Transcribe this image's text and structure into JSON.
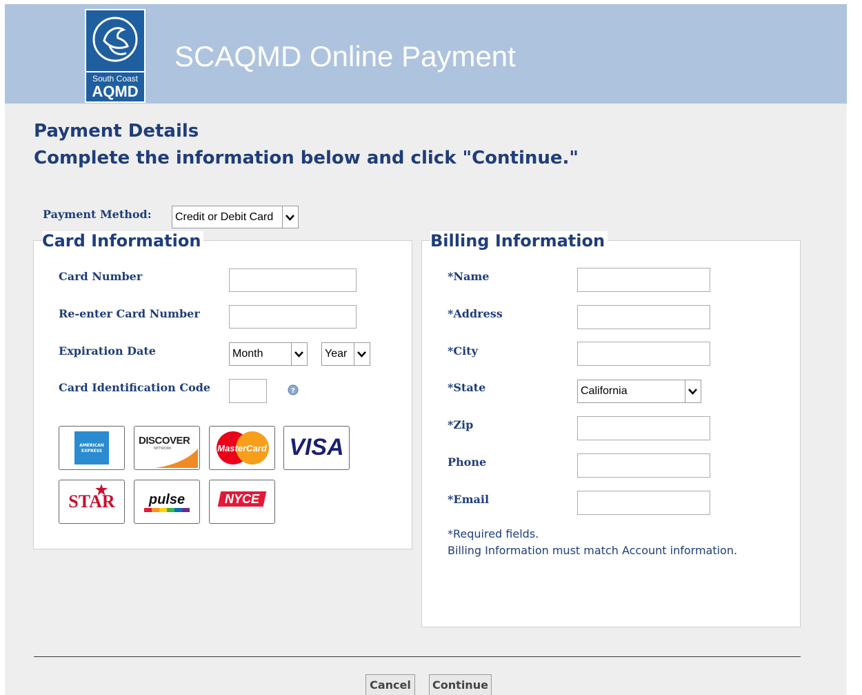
{
  "header": {
    "title": "SCAQMD Online Payment",
    "logo": {
      "line1": "South Coast",
      "line2": "AQMD"
    }
  },
  "heading": {
    "line1": "Payment Details",
    "line2": "Complete the information below and click \"Continue.\""
  },
  "payment_method": {
    "label": "Payment Method:",
    "value": "Credit or Debit Card"
  },
  "card_info": {
    "legend": "Card Information",
    "card_number_label": "Card Number",
    "reenter_label": "Re-enter Card Number",
    "expiration_label": "Expiration Date",
    "month_value": "Month",
    "year_value": "Year",
    "cid_label": "Card Identification Code",
    "card_brands": {
      "amex_line1": "AMERICAN",
      "amex_line2": "EXPRESS",
      "discover": "DISCOVER",
      "discover_sub": "NETWORK",
      "mastercard": "MasterCard",
      "visa": "VISA",
      "star": "STAR",
      "pulse": "pulse",
      "nyce": "NYCE"
    }
  },
  "billing": {
    "legend": "Billing Information",
    "name_label": "*Name",
    "address_label": "*Address",
    "city_label": "*City",
    "state_label": "*State",
    "state_value": "California",
    "zip_label": "*Zip",
    "phone_label": "Phone",
    "email_label": "*Email",
    "note1": "*Required fields.",
    "note2": "Billing Information must match Account information."
  },
  "actions": {
    "cancel": "Cancel",
    "continue": "Continue"
  },
  "colors": {
    "header_bg": "#aec3dd",
    "heading": "#1f3d7a",
    "logo_bg": "#1f5f9f",
    "page_bg": "#eeeeee"
  }
}
